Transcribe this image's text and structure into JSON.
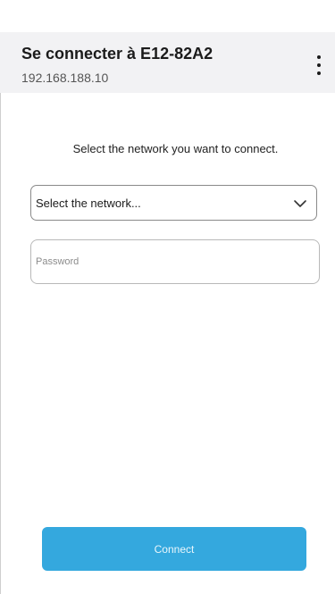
{
  "header": {
    "title": "Se connecter à E12-82A2",
    "subtitle": "192.168.188.10",
    "menu_icon": "more-vertical-icon"
  },
  "main": {
    "instruction": "Select the network you want to connect.",
    "network_select": {
      "value": "Select the network...",
      "icon": "chevron-down-icon"
    },
    "password": {
      "placeholder": "Password",
      "value": ""
    },
    "connect_label": "Connect"
  },
  "colors": {
    "header_background": "#f2f2f4",
    "accent": "#34a8de"
  }
}
